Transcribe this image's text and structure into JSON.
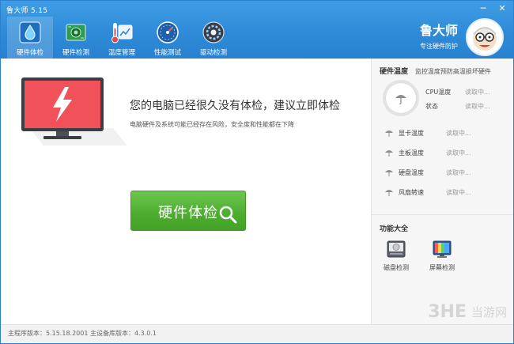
{
  "window": {
    "title": "鲁大师 5.15",
    "controls": {
      "minimize": "─",
      "close": "✕"
    }
  },
  "tabs": [
    {
      "label": "硬件体检",
      "icon": "shield-droplet-icon",
      "active": true
    },
    {
      "label": "硬件检测",
      "icon": "circuit-board-icon",
      "active": false
    },
    {
      "label": "温度管理",
      "icon": "thermometer-chart-icon",
      "active": false
    },
    {
      "label": "性能测试",
      "icon": "speedometer-icon",
      "active": false
    },
    {
      "label": "驱动检测",
      "icon": "gear-disk-icon",
      "active": false
    }
  ],
  "brand": {
    "name": "鲁大师",
    "slogan": "专注硬件防护",
    "avatar": "mascot-avatar-icon"
  },
  "main": {
    "headline": "您的电脑已经很久没有体检，建议立即体检",
    "subline": "电脑硬件及系统可能已经存在风险，安全度和性能都在下降",
    "check_button": "硬件体检",
    "illustration": "monitor-lightning-icon"
  },
  "right_panel": {
    "title": "硬件温度",
    "subtitle": "监控温度预防高温损坏硬件",
    "cpu": {
      "label": "CPU温度",
      "value": "读取中..."
    },
    "status": {
      "label": "状态",
      "value": "读取中..."
    },
    "sensors": [
      {
        "label": "显卡温度",
        "value": "读取中..."
      },
      {
        "label": "主板温度",
        "value": "读取中..."
      },
      {
        "label": "硬盘温度",
        "value": "读取中..."
      },
      {
        "label": "风扇转速",
        "value": "读取中..."
      }
    ],
    "functions_title": "功能大全",
    "functions": [
      {
        "label": "磁盘检测",
        "icon": "hard-disk-icon"
      },
      {
        "label": "屏幕检测",
        "icon": "screen-test-icon"
      }
    ]
  },
  "statusbar": {
    "text": "主程序版本：5.15.18.2001    主设备库版本：4.3.0.1"
  },
  "watermark": {
    "logo": "3HE",
    "text": "当游网"
  },
  "colors": {
    "header_blue": "#2f8bd8",
    "button_green": "#4fae31",
    "monitor_red": "#f15158"
  }
}
